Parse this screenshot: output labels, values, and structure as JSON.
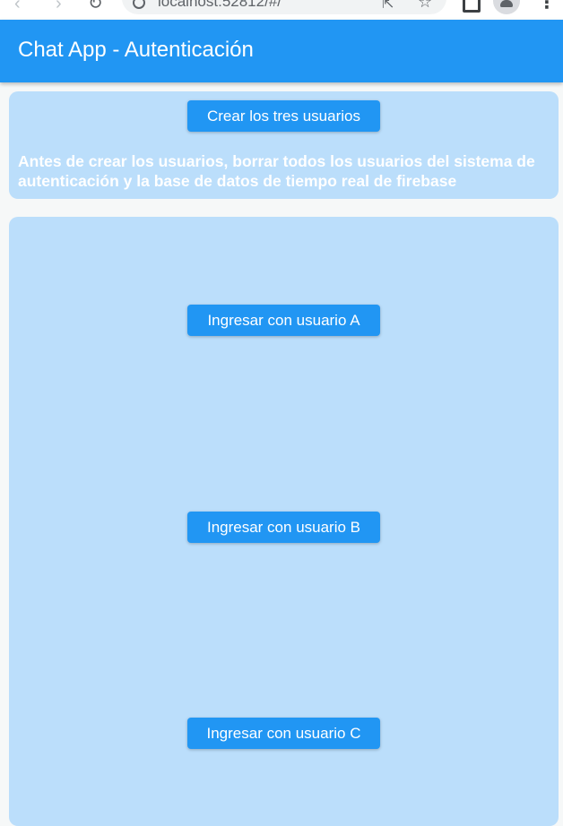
{
  "browser": {
    "url": "localhost:52812/#/",
    "icons": [
      "back-arrow-icon",
      "forward-arrow-icon",
      "reload-icon",
      "site-info-icon",
      "share-icon",
      "star-icon",
      "extension-icon",
      "profile-icon",
      "menu-icon"
    ]
  },
  "app_bar": {
    "title": "Chat App - Autenticación",
    "color": "#2196f3"
  },
  "setup": {
    "create_button": "Crear los tres usuarios",
    "warning": "Antes de crear los usuarios, borrar todos los usuarios del sistema de autenticación y la base de datos de tiempo real de firebase"
  },
  "login": {
    "user_a": "Ingresar con usuario A",
    "user_b": "Ingresar con usuario B",
    "user_c": "Ingresar con usuario C"
  },
  "colors": {
    "primary": "#2196f3",
    "card_background": "#bbdefb",
    "page_background": "#f6f8f8"
  }
}
